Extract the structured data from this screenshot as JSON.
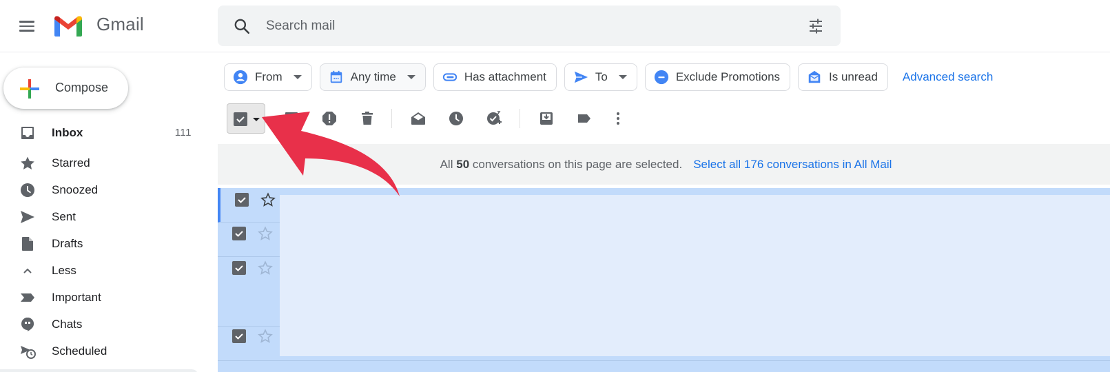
{
  "app": {
    "name": "Gmail",
    "brand_colors": {
      "red": "#ea4335",
      "blue": "#4285f4",
      "green": "#34a853",
      "yellow": "#fbbc04",
      "link": "#1a73e8"
    }
  },
  "header": {
    "menu_icon": "hamburger-menu-icon",
    "logo_text": "Gmail",
    "search": {
      "placeholder": "Search mail",
      "value": "",
      "left_icon": "search-icon",
      "right_icon": "tune-icon"
    }
  },
  "sidebar": {
    "compose_label": "Compose",
    "items": [
      {
        "label": "Inbox",
        "icon": "inbox-icon",
        "count": "111",
        "bold": true
      },
      {
        "label": "Starred",
        "icon": "star-icon"
      },
      {
        "label": "Snoozed",
        "icon": "clock-icon"
      },
      {
        "label": "Sent",
        "icon": "send-icon"
      },
      {
        "label": "Drafts",
        "icon": "draft-icon"
      },
      {
        "label": "Less",
        "icon": "chevron-up-icon"
      },
      {
        "label": "Important",
        "icon": "important-icon"
      },
      {
        "label": "Chats",
        "icon": "chat-icon"
      },
      {
        "label": "Scheduled",
        "icon": "scheduled-send-icon"
      }
    ]
  },
  "filters": {
    "chips": [
      {
        "label": "From",
        "icon": "person-icon",
        "dropdown": true
      },
      {
        "label": "Any time",
        "icon": "calendar-icon",
        "dropdown": true
      },
      {
        "label": "Has attachment",
        "icon": "paperclip-icon",
        "dropdown": false
      },
      {
        "label": "To",
        "icon": "send-icon",
        "dropdown": true
      },
      {
        "label": "Exclude Promotions",
        "icon": "minus-circle-icon",
        "dropdown": false
      },
      {
        "label": "Is unread",
        "icon": "unread-mail-icon",
        "dropdown": false
      }
    ],
    "advanced_search": "Advanced search"
  },
  "toolbar": {
    "select_all_checked": true,
    "actions": [
      "archive-icon",
      "report-spam-icon",
      "delete-icon",
      "mark-read-icon",
      "snooze-icon",
      "add-to-tasks-icon",
      "move-to-icon",
      "label-icon",
      "more-icon"
    ]
  },
  "banner": {
    "prefix": "All",
    "count": "50",
    "suffix": "conversations on this page are selected.",
    "link": "Select all 176 conversations in All Mail"
  },
  "rows": [
    {
      "checked": true,
      "starred": false
    },
    {
      "checked": true,
      "starred": false
    },
    {
      "checked": true,
      "starred": false
    },
    {
      "checked": true,
      "starred": false
    }
  ],
  "annotation": {
    "type": "arrow",
    "color": "#e8304a",
    "points_to": "select-all-checkbox"
  }
}
